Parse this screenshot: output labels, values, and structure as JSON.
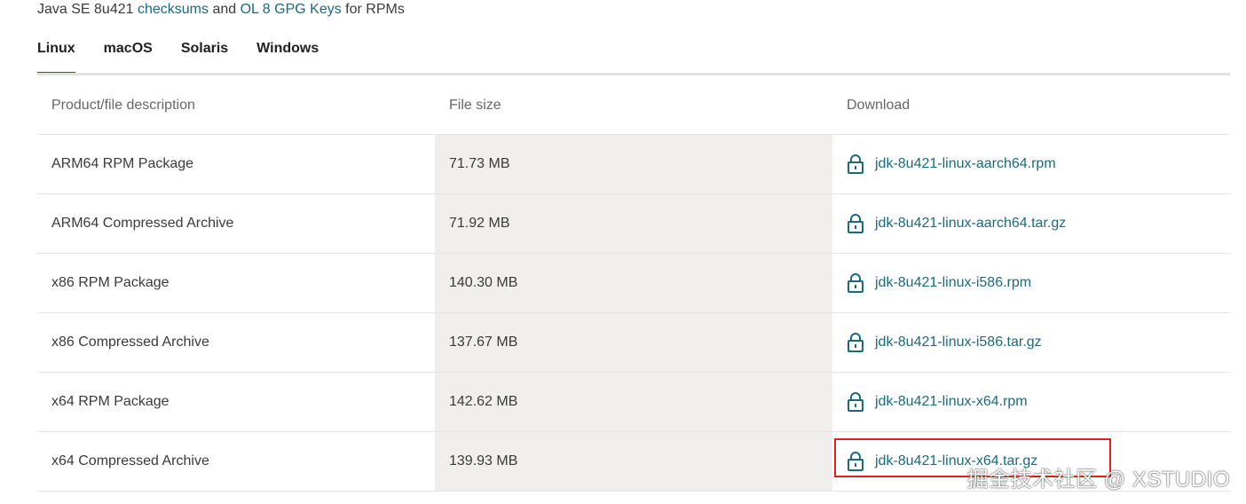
{
  "intro": {
    "prefix": "Java SE 8u421 ",
    "checksums_link": "checksums",
    "middle": " and ",
    "gpg_link": "OL 8 GPG Keys",
    "suffix": " for RPMs"
  },
  "tabs": [
    {
      "label": "Linux",
      "active": true
    },
    {
      "label": "macOS",
      "active": false
    },
    {
      "label": "Solaris",
      "active": false
    },
    {
      "label": "Windows",
      "active": false
    }
  ],
  "table": {
    "headers": [
      "Product/file description",
      "File size",
      "Download"
    ],
    "rows": [
      {
        "description": "ARM64 RPM Package",
        "size": "71.73 MB",
        "file": "jdk-8u421-linux-aarch64.rpm"
      },
      {
        "description": "ARM64 Compressed Archive",
        "size": "71.92 MB",
        "file": "jdk-8u421-linux-aarch64.tar.gz"
      },
      {
        "description": "x86 RPM Package",
        "size": "140.30 MB",
        "file": "jdk-8u421-linux-i586.rpm"
      },
      {
        "description": "x86 Compressed Archive",
        "size": "137.67 MB",
        "file": "jdk-8u421-linux-i586.tar.gz"
      },
      {
        "description": "x64 RPM Package",
        "size": "142.62 MB",
        "file": "jdk-8u421-linux-x64.rpm"
      },
      {
        "description": "x64 Compressed Archive",
        "size": "139.93 MB",
        "file": "jdk-8u421-linux-x64.tar.gz"
      }
    ]
  },
  "icons": {
    "download": "lock-icon"
  },
  "colors": {
    "link": "#1a6a7d",
    "highlight": "#e0201f",
    "active_tab": "#4d5a3a",
    "size_column_bg": "#f0efed"
  },
  "watermark": "掘金技术社区 @ XSTUDIO"
}
